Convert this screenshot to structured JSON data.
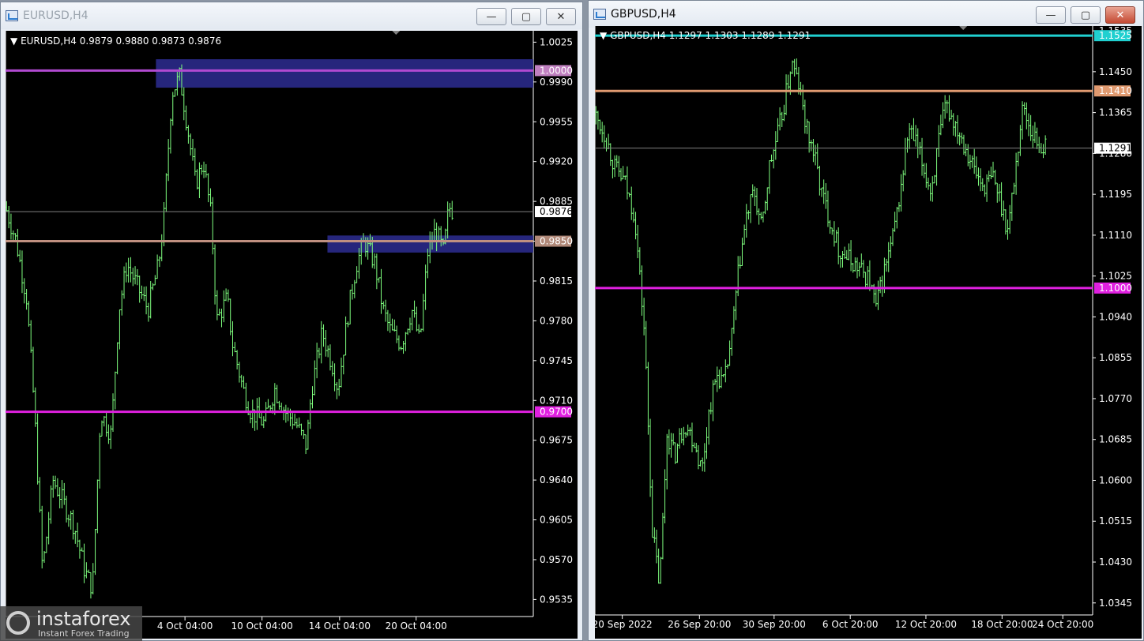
{
  "windows": [
    {
      "title": "EURUSD,H4",
      "active": false,
      "ohlc_label": "EURUSD,H4  0.9879 0.9880 0.9873 0.9876"
    },
    {
      "title": "GBPUSD,H4",
      "active": true,
      "ohlc_label": "GBPUSD,H4  1.1297 1.1303 1.1289 1.1291"
    }
  ],
  "buttons": {
    "minimize": "—",
    "maximize": "▢",
    "close": "✕"
  },
  "watermark": {
    "name": "instaforex",
    "tagline": "Instant Forex Trading"
  },
  "colors": {
    "candles": "#7fff7f",
    "background": "#000000"
  },
  "chart_data": [
    {
      "type": "candlestick",
      "symbol": "EURUSD",
      "timeframe": "H4",
      "ylim": [
        0.952,
        1.0035
      ],
      "yticks": [
        "1.0025",
        "0.9990",
        "0.9955",
        "0.9920",
        "0.9885",
        "0.9850",
        "0.9815",
        "0.9780",
        "0.9745",
        "0.9710",
        "0.9675",
        "0.9640",
        "0.9605",
        "0.9570",
        "0.9535"
      ],
      "xticks": [
        {
          "label": "4 Oct 04:00",
          "frac": 0.34
        },
        {
          "label": "10 Oct 04:00",
          "frac": 0.486
        },
        {
          "label": "14 Oct 04:00",
          "frac": 0.633
        },
        {
          "label": "20 Oct 04:00",
          "frac": 0.778
        }
      ],
      "current_price": "0.9876",
      "hlines": [
        {
          "value": 1.0,
          "label": "1.0000",
          "color": "#b04ad0",
          "label_bg": "#c080c0"
        },
        {
          "value": 0.985,
          "label": "0.9850",
          "color": "#c09080",
          "label_bg": "#b08878"
        },
        {
          "value": 0.97,
          "label": "0.9700",
          "color": "#e020e0",
          "label_bg": "#e020e0"
        }
      ],
      "zones": [
        {
          "x_from": 0.285,
          "x_to": 1.0,
          "y_top": 1.001,
          "y_bottom": 0.9985
        },
        {
          "x_from": 0.61,
          "x_to": 1.0,
          "y_top": 0.9855,
          "y_bottom": 0.984
        }
      ],
      "series_path": [
        [
          0,
          0.988
        ],
        [
          0.02,
          0.985
        ],
        [
          0.04,
          0.98
        ],
        [
          0.055,
          0.97
        ],
        [
          0.07,
          0.956
        ],
        [
          0.09,
          0.964
        ],
        [
          0.11,
          0.962
        ],
        [
          0.13,
          0.96
        ],
        [
          0.15,
          0.956
        ],
        [
          0.165,
          0.9545
        ],
        [
          0.18,
          0.97
        ],
        [
          0.2,
          0.968
        ],
        [
          0.215,
          0.979
        ],
        [
          0.23,
          0.983
        ],
        [
          0.25,
          0.981
        ],
        [
          0.27,
          0.979
        ],
        [
          0.29,
          0.983
        ],
        [
          0.3,
          0.987
        ],
        [
          0.315,
          0.998
        ],
        [
          0.33,
          0.9995
        ],
        [
          0.345,
          0.995
        ],
        [
          0.36,
          0.99
        ],
        [
          0.375,
          0.992
        ],
        [
          0.39,
          0.987
        ],
        [
          0.4,
          0.978
        ],
        [
          0.42,
          0.98
        ],
        [
          0.43,
          0.976
        ],
        [
          0.45,
          0.972
        ],
        [
          0.465,
          0.97
        ],
        [
          0.49,
          0.969
        ],
        [
          0.51,
          0.972
        ],
        [
          0.53,
          0.97
        ],
        [
          0.55,
          0.969
        ],
        [
          0.57,
          0.967
        ],
        [
          0.58,
          0.972
        ],
        [
          0.6,
          0.977
        ],
        [
          0.62,
          0.974
        ],
        [
          0.63,
          0.972
        ],
        [
          0.65,
          0.979
        ],
        [
          0.665,
          0.983
        ],
        [
          0.68,
          0.985
        ],
        [
          0.7,
          0.983
        ],
        [
          0.715,
          0.979
        ],
        [
          0.73,
          0.977
        ],
        [
          0.75,
          0.976
        ],
        [
          0.77,
          0.979
        ],
        [
          0.785,
          0.976
        ],
        [
          0.8,
          0.984
        ],
        [
          0.815,
          0.986
        ],
        [
          0.83,
          0.984
        ],
        [
          0.84,
          0.988
        ],
        [
          0.85,
          0.9876
        ]
      ]
    },
    {
      "type": "candlestick",
      "symbol": "GBPUSD",
      "timeframe": "H4",
      "ylim": [
        1.032,
        1.1545
      ],
      "yticks": [
        "1.1535",
        "1.1450",
        "1.1365",
        "1.1280",
        "1.1195",
        "1.1110",
        "1.1025",
        "1.0940",
        "1.0855",
        "1.0770",
        "1.0685",
        "1.0600",
        "1.0515",
        "1.0430",
        "1.0345"
      ],
      "xticks": [
        {
          "label": "20 Sep 2022",
          "frac": 0.055
        },
        {
          "label": "26 Sep 20:00",
          "frac": 0.21
        },
        {
          "label": "30 Sep 20:00",
          "frac": 0.36
        },
        {
          "label": "6 Oct 20:00",
          "frac": 0.513
        },
        {
          "label": "12 Oct 20:00",
          "frac": 0.665
        },
        {
          "label": "18 Oct 20:00",
          "frac": 0.818
        },
        {
          "label": "24 Oct 20:00",
          "frac": 0.94
        }
      ],
      "current_price": "1.1291",
      "hlines": [
        {
          "value": 1.1525,
          "label": "1.1525",
          "color": "#20d0d0",
          "label_bg": "#20d0d0"
        },
        {
          "value": 1.141,
          "label": "1.1410",
          "color": "#e09a70",
          "label_bg": "#e09a70"
        },
        {
          "value": 1.1,
          "label": "1.1000",
          "color": "#e020e0",
          "label_bg": "#e020e0"
        }
      ],
      "zones": [],
      "series_path": [
        [
          0,
          1.136
        ],
        [
          0.02,
          1.132
        ],
        [
          0.04,
          1.125
        ],
        [
          0.06,
          1.122
        ],
        [
          0.08,
          1.115
        ],
        [
          0.1,
          1.09
        ],
        [
          0.115,
          1.05
        ],
        [
          0.13,
          1.038
        ],
        [
          0.145,
          1.07
        ],
        [
          0.16,
          1.065
        ],
        [
          0.18,
          1.072
        ],
        [
          0.2,
          1.068
        ],
        [
          0.215,
          1.062
        ],
        [
          0.23,
          1.075
        ],
        [
          0.245,
          1.082
        ],
        [
          0.26,
          1.08
        ],
        [
          0.275,
          1.09
        ],
        [
          0.29,
          1.105
        ],
        [
          0.305,
          1.115
        ],
        [
          0.32,
          1.12
        ],
        [
          0.335,
          1.112
        ],
        [
          0.35,
          1.125
        ],
        [
          0.365,
          1.131
        ],
        [
          0.38,
          1.138
        ],
        [
          0.395,
          1.147
        ],
        [
          0.41,
          1.142
        ],
        [
          0.425,
          1.133
        ],
        [
          0.44,
          1.128
        ],
        [
          0.455,
          1.12
        ],
        [
          0.47,
          1.115
        ],
        [
          0.49,
          1.108
        ],
        [
          0.51,
          1.106
        ],
        [
          0.53,
          1.104
        ],
        [
          0.55,
          1.102
        ],
        [
          0.565,
          1.096
        ],
        [
          0.58,
          1.103
        ],
        [
          0.6,
          1.111
        ],
        [
          0.615,
          1.121
        ],
        [
          0.63,
          1.133
        ],
        [
          0.645,
          1.13
        ],
        [
          0.66,
          1.125
        ],
        [
          0.675,
          1.12
        ],
        [
          0.69,
          1.13
        ],
        [
          0.705,
          1.138
        ],
        [
          0.72,
          1.135
        ],
        [
          0.735,
          1.132
        ],
        [
          0.75,
          1.128
        ],
        [
          0.765,
          1.124
        ],
        [
          0.78,
          1.121
        ],
        [
          0.8,
          1.123
        ],
        [
          0.815,
          1.118
        ],
        [
          0.83,
          1.112
        ],
        [
          0.845,
          1.125
        ],
        [
          0.86,
          1.138
        ],
        [
          0.875,
          1.133
        ],
        [
          0.89,
          1.13
        ],
        [
          0.905,
          1.1291
        ]
      ]
    }
  ]
}
